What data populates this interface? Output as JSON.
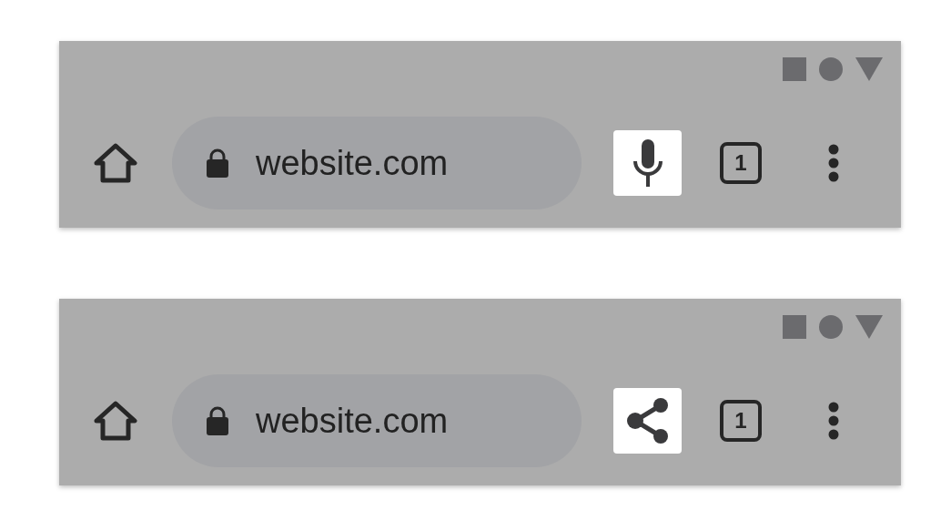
{
  "toolbars": [
    {
      "address": "website.com",
      "action": {
        "kind": "mic",
        "highlighted": true
      },
      "tab_count": "1"
    },
    {
      "address": "website.com",
      "action": {
        "kind": "share",
        "highlighted": true
      },
      "tab_count": "1"
    }
  ]
}
